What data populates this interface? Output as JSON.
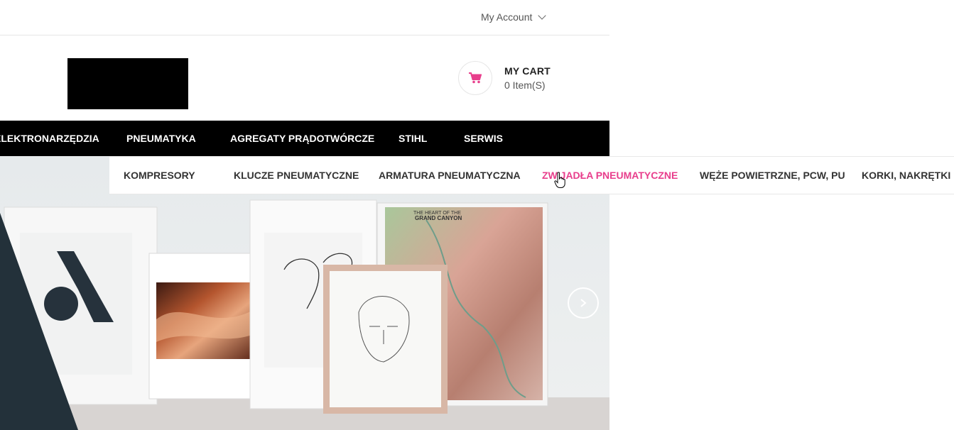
{
  "topbar": {
    "account_label": "My Account"
  },
  "header": {
    "cart_title": "MY CART",
    "cart_count": "0 Item(S)"
  },
  "main_nav": [
    {
      "label": "ELEKTRONARZĘDZIA"
    },
    {
      "label": "PNEUMATYKA"
    },
    {
      "label": "AGREGATY PRĄDOTWÓRCZE"
    },
    {
      "label": "STIHL"
    },
    {
      "label": "SERWIS"
    }
  ],
  "submenu": [
    {
      "label": "KOMPRESORY"
    },
    {
      "label": "KLUCZE PNEUMATYCZNE"
    },
    {
      "label": "ARMATURA PNEUMATYCZNA"
    },
    {
      "label": "ZWIJADŁA PNEUMATYCZNE"
    },
    {
      "label": "WĘŻE POWIETRZNE, PCW, PU"
    },
    {
      "label": "KORKI, NAKRĘTKI"
    }
  ],
  "hero_map": {
    "title_line1": "THE HEART OF THE",
    "title_line2": "GRAND CANYON"
  },
  "colors": {
    "accent": "#e83e8c",
    "nav_bg": "#000000"
  },
  "icons": {
    "cart": "cart-icon",
    "chevron": "chevron-down-icon",
    "next": "chevron-right-icon"
  }
}
